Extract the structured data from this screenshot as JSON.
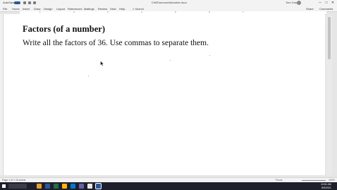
{
  "titlebar": {
    "autosave": "AutoSave",
    "document_title": "CH6FactorsofaNumber.docx",
    "user": "Tom Grant",
    "minimize": "─",
    "maximize": "□",
    "close": "✕"
  },
  "menubar": {
    "tabs": [
      "File",
      "Home",
      "Insert",
      "Draw",
      "Design",
      "Layout",
      "References",
      "Mailings",
      "Review",
      "View",
      "Help"
    ],
    "search": "Search",
    "share": "Share",
    "comments": "Comments"
  },
  "ruler": {
    "numbers": [
      "1",
      "2",
      "3",
      "4",
      "5",
      "6",
      "7"
    ]
  },
  "document": {
    "heading": "Factors (of a number)",
    "body": "Write all the factors of 36.  Use commas to separate them."
  },
  "statusbar": {
    "page": "Page 1 of 1",
    "words": "15 words",
    "focus": "Focus",
    "zoom": "100%"
  },
  "taskbar": {
    "time": "10:51 AM",
    "date": "8/5/2021",
    "icon_colors": [
      "#e0a030",
      "#2b579a",
      "#1e7145",
      "#ffb900",
      "#0078d4",
      "#6264a7",
      "#e8e8e8",
      "#2b579a"
    ]
  },
  "colors": {
    "accent": "#2b579a",
    "taskbar": "#1f1f2b"
  }
}
